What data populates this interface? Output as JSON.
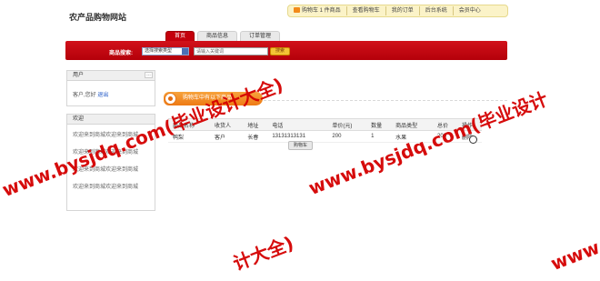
{
  "site": {
    "title": "农产品购物网站"
  },
  "topbar": {
    "cart_label": "购物车 1 件商品",
    "view_cart": "查看购物车",
    "my_orders": "我的订单",
    "admin": "后台系统",
    "member_center": "会员中心"
  },
  "nav": {
    "tabs": [
      "首页",
      "商品信息",
      "订单管理"
    ],
    "active": 0
  },
  "search": {
    "label": "商品搜索:",
    "select_value": "选择搜索类型",
    "placeholder": "请输入关键词",
    "button": "搜索"
  },
  "sidebar": {
    "user_title": "用户",
    "more": "…",
    "greeting": "客户,您好",
    "logout": "退出",
    "welcome_title": "欢迎",
    "welcome_lines": [
      "欢迎来到商城欢迎来到商城",
      "欢迎来到商城欢迎来到商城",
      "欢迎来到商城欢迎来到商城",
      "欢迎来到商城欢迎来到商城"
    ]
  },
  "main": {
    "notice": "购物车中有以下商品",
    "table": {
      "headers": [
        "商品名称",
        "收货人",
        "地址",
        "电话",
        "单价(元)",
        "数量",
        "商品类型",
        "总价",
        "操作"
      ],
      "rows": [
        [
          "鸭梨",
          "客户",
          "长春",
          "13131313131",
          "200",
          "1",
          "水果",
          "200",
          "删除"
        ]
      ]
    },
    "cart_button": "购物车"
  },
  "watermark": {
    "text_a": "www.bysjdq.com(毕业设计大全)",
    "text_b": "www.bysjdq.com(毕业设计",
    "text_c": "计大全)",
    "text_d": "www."
  },
  "colors": {
    "brand_red": "#c4000c",
    "notice_orange": "#ef8420",
    "topbar_bg": "#fbf3c8"
  }
}
